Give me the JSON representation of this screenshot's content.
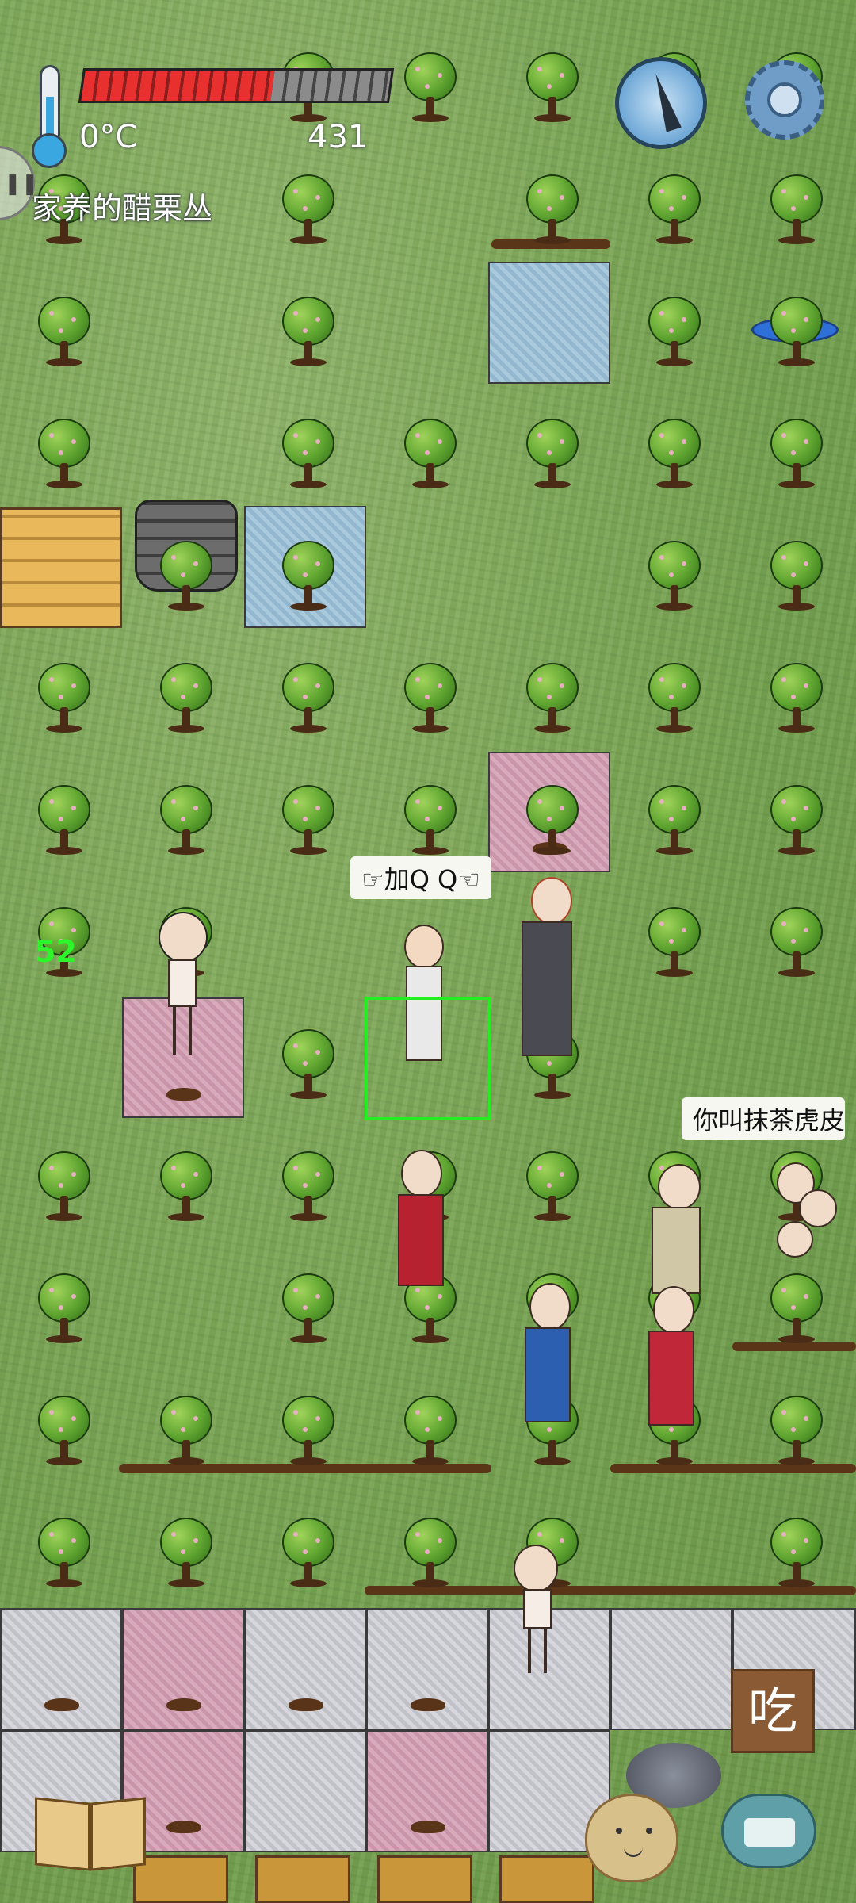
{
  "hud": {
    "temperature_label": "0°C",
    "food_count": "431",
    "food_fill_fraction": 0.62,
    "object_label": "家养的醋栗丛",
    "age_label": "52"
  },
  "speech": {
    "bubble_1": "☞加Q Q☜",
    "bubble_2": "你叫抹茶虎皮"
  },
  "buttons": {
    "eat_label": "吃"
  },
  "icons": [
    "thermometer-icon",
    "compass-icon",
    "gear-icon",
    "book-icon",
    "emote-face-icon",
    "keyboard-icon"
  ],
  "colors": {
    "grass": "#7fa65a",
    "select_box": "#22ee22",
    "age_label": "#2cf52c",
    "eat_button": "#8a5a34",
    "food_bar": "#e8312f"
  }
}
